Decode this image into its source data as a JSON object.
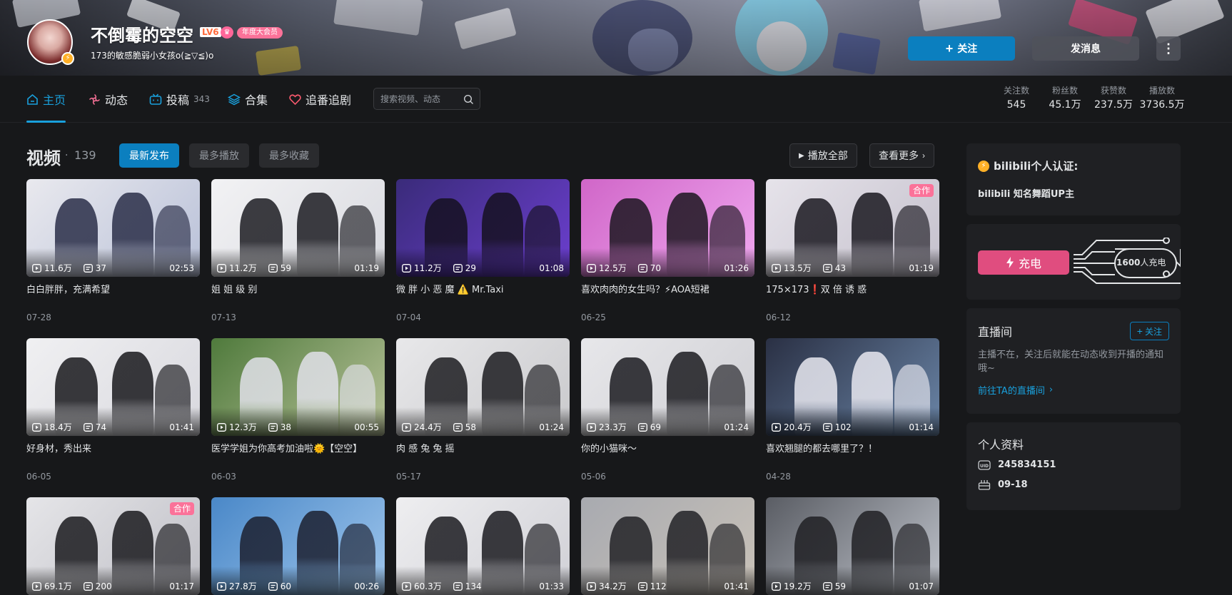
{
  "header": {
    "username": "不倒霉的空空",
    "level": "LV6",
    "medal_icon": "fan-medal-icon",
    "annual_badge": "年度大会员",
    "signature": "173的敏感脆弱小女孩o(≧▽≦)o",
    "follow_label": "关注",
    "message_label": "发消息",
    "more_icon": "more-vertical-icon"
  },
  "nav": {
    "items": [
      {
        "label": "主页",
        "icon": "home-icon"
      },
      {
        "label": "动态",
        "icon": "dynamic-icon"
      },
      {
        "label": "投稿",
        "count": "343",
        "icon": "tv-icon"
      },
      {
        "label": "合集",
        "icon": "layers-icon"
      },
      {
        "label": "追番追剧",
        "icon": "heart-icon"
      }
    ],
    "search_placeholder": "搜索视频、动态"
  },
  "stats": [
    {
      "label": "关注数",
      "value": "545"
    },
    {
      "label": "粉丝数",
      "value": "45.1万"
    },
    {
      "label": "获赞数",
      "value": "237.5万"
    },
    {
      "label": "播放数",
      "value": "3736.5万"
    }
  ],
  "videos_section": {
    "title": "视频",
    "dot": "·",
    "count": "139",
    "tabs": [
      "最新发布",
      "最多播放",
      "最多收藏"
    ],
    "play_all": "播放全部",
    "see_more": "查看更多"
  },
  "videos": [
    {
      "plays": "11.6万",
      "danmaku": "37",
      "duration": "02:53",
      "title": "白白胖胖，充满希望",
      "date": "07-28"
    },
    {
      "plays": "11.2万",
      "danmaku": "59",
      "duration": "01:19",
      "title": "姐 姐 级 别",
      "date": "07-13"
    },
    {
      "plays": "11.2万",
      "danmaku": "29",
      "duration": "01:08",
      "title": "微 胖 小 恶 魔 ⚠️ Mr.Taxi",
      "date": "07-04"
    },
    {
      "plays": "12.5万",
      "danmaku": "70",
      "duration": "01:26",
      "title": "喜欢肉肉的女生吗？⚡AOA短裙",
      "date": "06-25"
    },
    {
      "plays": "13.5万",
      "danmaku": "43",
      "duration": "01:19",
      "title": "175×173❗双 倍 诱 惑",
      "date": "06-12",
      "badge": "合作"
    },
    {
      "plays": "18.4万",
      "danmaku": "74",
      "duration": "01:41",
      "title": "好身材，秀出来",
      "date": "06-05"
    },
    {
      "plays": "12.3万",
      "danmaku": "38",
      "duration": "00:55",
      "title": "医学学姐为你高考加油啦🌞【空空】",
      "date": "06-03"
    },
    {
      "plays": "24.4万",
      "danmaku": "58",
      "duration": "01:24",
      "title": "肉 感 兔 兔 摇",
      "date": "05-17"
    },
    {
      "plays": "23.3万",
      "danmaku": "69",
      "duration": "01:24",
      "title": "你的小猫咪～",
      "date": "05-06"
    },
    {
      "plays": "20.4万",
      "danmaku": "102",
      "duration": "01:14",
      "title": "喜欢翘腿的都去哪里了？！",
      "date": "04-28"
    },
    {
      "plays": "69.1万",
      "danmaku": "200",
      "duration": "01:17",
      "badge": "合作"
    },
    {
      "plays": "27.8万",
      "danmaku": "60",
      "duration": "00:26"
    },
    {
      "plays": "60.3万",
      "danmaku": "134",
      "duration": "01:33"
    },
    {
      "plays": "34.2万",
      "danmaku": "112",
      "duration": "01:41"
    },
    {
      "plays": "19.2万",
      "danmaku": "59",
      "duration": "01:07"
    }
  ],
  "sidebar": {
    "cert_title": "bilibili个人认证:",
    "cert_text": "bilibili 知名舞蹈UP主",
    "charge_label": "充电",
    "charge_count": "1600",
    "charge_suffix": "人充电",
    "live_title": "直播间",
    "live_follow": "关注",
    "live_desc": "主播不在，关注后就能在动态收到开播的通知哦~",
    "live_link": "前往TA的直播间",
    "profile_title": "个人资料",
    "uid": "245834151",
    "birthday": "09-18"
  },
  "colors": {
    "accent": "#0b7fbf",
    "pink": "#fb7299",
    "charge": "#e04d7f",
    "bg": "#17181a",
    "panel": "#1f2023"
  }
}
